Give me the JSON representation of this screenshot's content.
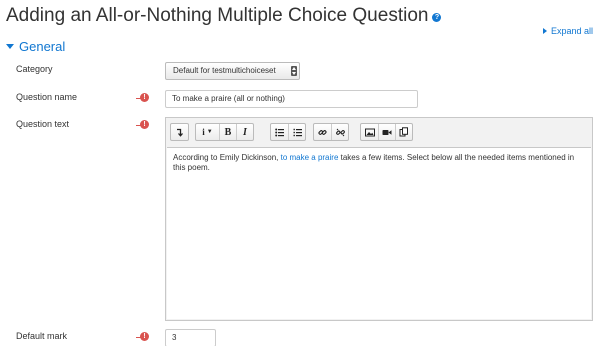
{
  "page": {
    "title": "Adding an All-or-Nothing Multiple Choice Question",
    "help_icon": "question-circle-icon",
    "expand_all": "Expand all"
  },
  "section": {
    "title": "General"
  },
  "fields": {
    "category": {
      "label": "Category",
      "selected": "Default for testmultichoiceset"
    },
    "question_name": {
      "label": "Question name",
      "value": "To make a praire (all or nothing)",
      "required": true
    },
    "question_text": {
      "label": "Question text",
      "required": true,
      "content_before": "According to Emily Dickinson, ",
      "content_link": "to make a praire",
      "content_after": " takes a few items. Select below all the needed items mentioned in this poem."
    },
    "default_mark": {
      "label": "Default mark",
      "value": "3",
      "required": true
    }
  },
  "toolbar": {
    "buttons": [
      "show-more-icon",
      "paragraph-style-icon",
      "bold-icon",
      "italic-icon",
      "bullet-list-icon",
      "numbered-list-icon",
      "link-icon",
      "unlink-icon",
      "image-icon",
      "media-icon",
      "manage-files-icon"
    ],
    "paragraph_glyph": "i",
    "bold_glyph": "B",
    "italic_glyph": "I"
  },
  "colors": {
    "link": "#1177d1",
    "required": "#d9534f",
    "text": "#333333"
  }
}
